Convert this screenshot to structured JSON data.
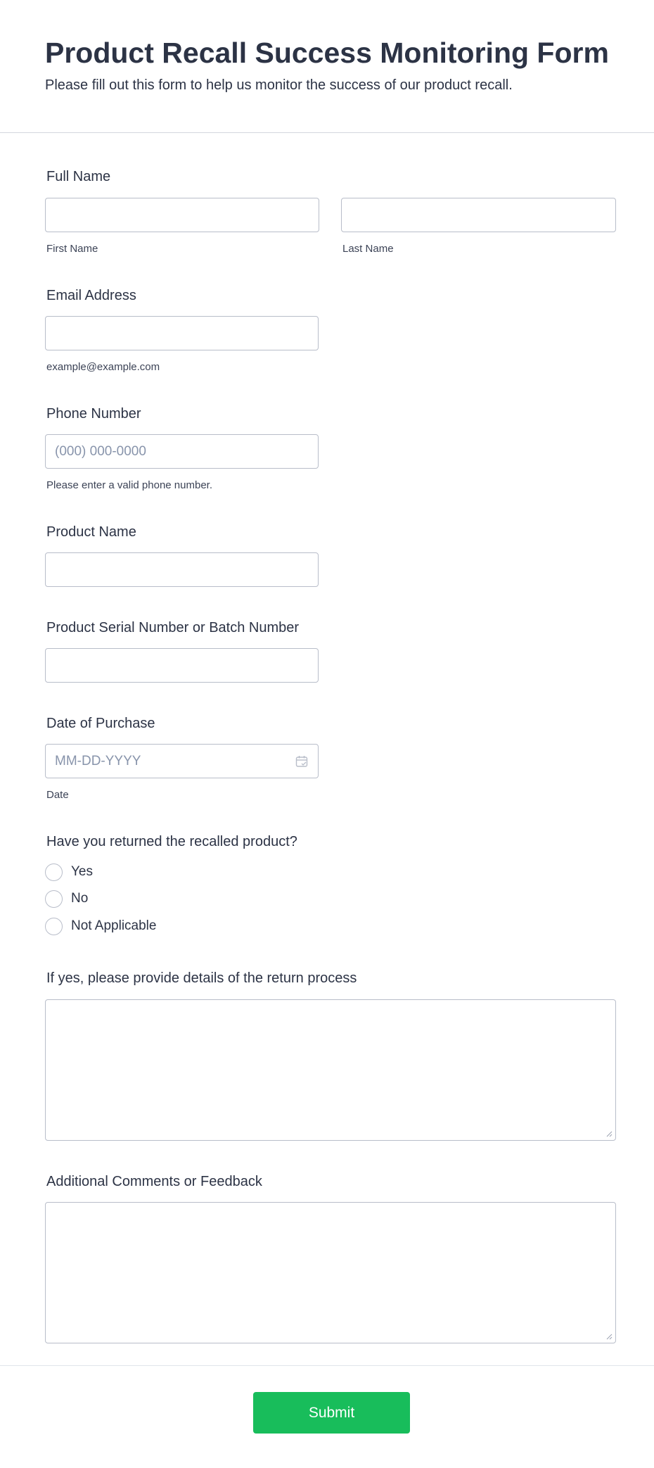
{
  "header": {
    "title": "Product Recall Success Monitoring Form",
    "subtitle": "Please fill out this form to help us monitor the success of our product recall."
  },
  "full_name": {
    "label": "Full Name",
    "first_sublabel": "First Name",
    "last_sublabel": "Last Name",
    "first_value": "",
    "last_value": ""
  },
  "email": {
    "label": "Email Address",
    "sublabel": "example@example.com",
    "value": ""
  },
  "phone": {
    "label": "Phone Number",
    "placeholder": "(000) 000-0000",
    "sublabel": "Please enter a valid phone number."
  },
  "product_name": {
    "label": "Product Name",
    "value": ""
  },
  "serial": {
    "label": "Product Serial Number or Batch Number",
    "value": ""
  },
  "date": {
    "label": "Date of Purchase",
    "placeholder": "MM-DD-YYYY",
    "sublabel": "Date",
    "icon": "calendar-icon"
  },
  "returned": {
    "label": "Have you returned the recalled product?",
    "options": [
      {
        "label": "Yes",
        "selected": false
      },
      {
        "label": "No",
        "selected": false
      },
      {
        "label": "Not Applicable",
        "selected": false
      }
    ]
  },
  "return_details": {
    "label": "If yes, please provide details of the return process",
    "value": ""
  },
  "comments": {
    "label": "Additional Comments or Feedback",
    "value": ""
  },
  "submit": {
    "label": "Submit"
  },
  "colors": {
    "text": "#2c3345",
    "border": "#b8bdc9",
    "placeholder": "#8894ab",
    "submit_bg": "#18bd5b"
  }
}
